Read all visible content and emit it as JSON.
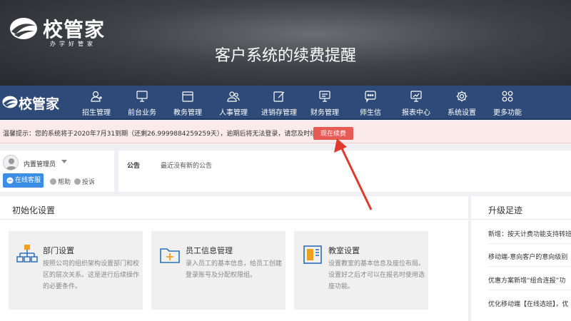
{
  "banner": {
    "logo_text": "校管家",
    "logo_slogan": "办学好管家",
    "title": "客户系统的续费提醒"
  },
  "nav": {
    "logo_text": "校管家",
    "items": [
      {
        "label": "招生管理",
        "icon": "enroll-user-icon"
      },
      {
        "label": "前台业务",
        "icon": "monitor-icon"
      },
      {
        "label": "教务管理",
        "icon": "calendar-box-icon"
      },
      {
        "label": "人事管理",
        "icon": "people-icon"
      },
      {
        "label": "进销存管理",
        "icon": "edit-box-icon"
      },
      {
        "label": "财务管理",
        "icon": "finance-icon"
      },
      {
        "label": "师生信",
        "icon": "message-icon"
      },
      {
        "label": "报表中心",
        "icon": "chart-monitor-icon"
      },
      {
        "label": "系统设置",
        "icon": "gear-icon"
      },
      {
        "label": "更多功能",
        "icon": "grid-more-icon"
      }
    ],
    "colors": {
      "bar": "#2d4a78"
    }
  },
  "alert": {
    "text": "温馨提示：您的系统将于2020年7月31到期（还剩26.9999884259259天），逾期后将无法登录，请您及时续费。",
    "button_label": "现在续费",
    "button_color": "#e85b54"
  },
  "user": {
    "name": "内置管理员",
    "service_label": "在线客服",
    "help_label": "帮助",
    "complain_label": "投诉"
  },
  "notice": {
    "label": "公告",
    "text": "最近没有新的公告"
  },
  "init": {
    "title": "初始化设置",
    "cards": [
      {
        "title": "部门设置",
        "desc": "按照公司的组织架构设置部门和校区的层次关系。这是进行后续操作的必要条件。",
        "icon": "org-chart-icon"
      },
      {
        "title": "员工信息管理",
        "desc": "录入员工的基本信息，给员工创建登录账号及分配权限组。",
        "icon": "folder-plus-icon"
      },
      {
        "title": "教室设置",
        "desc": "设置教室的基本信息及座位布局。设置好之后才可以在报名时使用选座功能。",
        "icon": "classroom-layout-icon"
      }
    ]
  },
  "upgrade": {
    "title": "升级足迹",
    "items": [
      "新增：按天计费功能支持转班",
      "移动端-意向客户的意向级别",
      "优惠方案新增“组合连报”功",
      "优化移动端【在线选班】，优"
    ]
  }
}
